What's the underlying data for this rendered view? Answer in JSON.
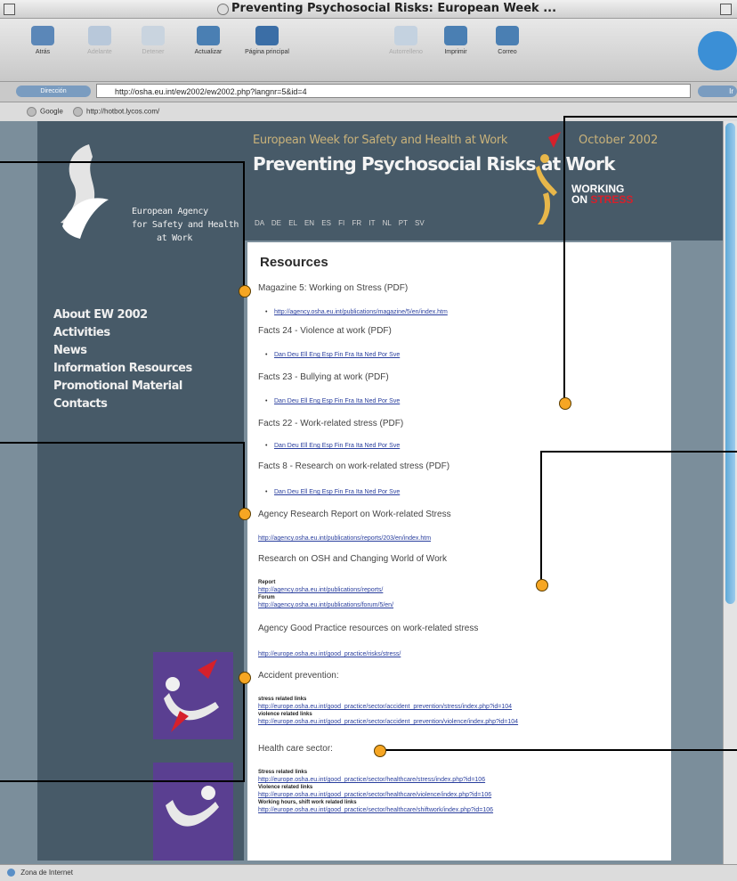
{
  "window": {
    "title": "Preventing Psychosocial Risks: European Week ..."
  },
  "toolbar": {
    "buttons": [
      {
        "label": "Atrás",
        "enabled": true
      },
      {
        "label": "Adelante",
        "enabled": false
      },
      {
        "label": "Detener",
        "enabled": false
      },
      {
        "label": "Actualizar",
        "enabled": true
      },
      {
        "label": "Página principal",
        "enabled": true
      },
      {
        "label": "Autorrelleno",
        "enabled": false
      },
      {
        "label": "Imprimir",
        "enabled": true
      },
      {
        "label": "Correo",
        "enabled": true
      }
    ]
  },
  "address": {
    "label": "Dirección",
    "url": "http://osha.eu.int/ew2002/ew2002.php?langnr=5&id=4",
    "go": "Ir"
  },
  "favorites": [
    "Google",
    "http://hotbot.lycos.com/"
  ],
  "status": {
    "text": "Zona de Internet"
  },
  "sidebar": {
    "org": [
      "European Agency",
      "for Safety and Health",
      "at Work"
    ],
    "nav": [
      "About EW 2002",
      "Activities",
      "News",
      "Information Resources",
      "Promotional Material",
      "Contacts"
    ]
  },
  "header": {
    "week": "European Week for Safety and Health at Work",
    "date": "October 2002",
    "title": "Preventing Psychosocial Risks at Work",
    "working": "WORKING",
    "on": "ON",
    "stress": "STRESS",
    "languages": "DA DE EL EN ES FI FR IT NL PT SV"
  },
  "content": {
    "heading": "Resources",
    "magazine_title": "Magazine 5: Working on Stress (PDF)",
    "magazine_link": "http://agency.osha.eu.int/publications/magazine/5/en/index.htm",
    "facts24_title": "Facts 24 - Violence at work (PDF)",
    "facts23_title": "Facts 23 - Bullying at work (PDF)",
    "facts22_title": "Facts 22 - Work-related stress (PDF)",
    "facts8_title": "Facts 8 - Research on work-related stress (PDF)",
    "lang_links": "Dan Deu Ell Eng Esp Fin Fra Ita Ned Por Sve",
    "report_title": "Agency Research Report on Work-related Stress",
    "report_link": "http://agency.osha.eu.int/publications/reports/203/en/index.htm",
    "research_title": "Research on OSH and Changing World of Work",
    "research_sub1": "Report",
    "research_link1": "http://agency.osha.eu.int/publications/reports/",
    "research_sub2": "Forum",
    "research_link2": "http://agency.osha.eu.int/publications/forum/5/en/",
    "goodpractice_title": "Agency Good Practice resources on work-related stress",
    "goodpractice_link": "http://europe.osha.eu.int/good_practice/risks/stress/",
    "accident_title": "Accident prevention:",
    "accident_sub1": "stress related links",
    "accident_link1": "http://europe.osha.eu.int/good_practice/sector/accident_prevention/stress/index.php?id=104",
    "accident_sub2": "violence related links",
    "accident_link2": "http://europe.osha.eu.int/good_practice/sector/accident_prevention/violence/index.php?id=104",
    "health_title": "Health care sector:",
    "health_sub1": "Stress related links",
    "health_link1": "http://europe.osha.eu.int/good_practice/sector/healthcare/stress/index.php?id=106",
    "health_sub2": "Violence related links",
    "health_link2": "http://europe.osha.eu.int/good_practice/sector/healthcare/violence/index.php?id=106",
    "health_sub3": "Working hours, shift work related links",
    "health_link3": "http://europe.osha.eu.int/good_practice/sector/healthcare/shiftwork/index.php?id=106"
  },
  "colors": {
    "panel": "#475a68",
    "callout": "#f6a623",
    "link": "#2a3f9e"
  }
}
